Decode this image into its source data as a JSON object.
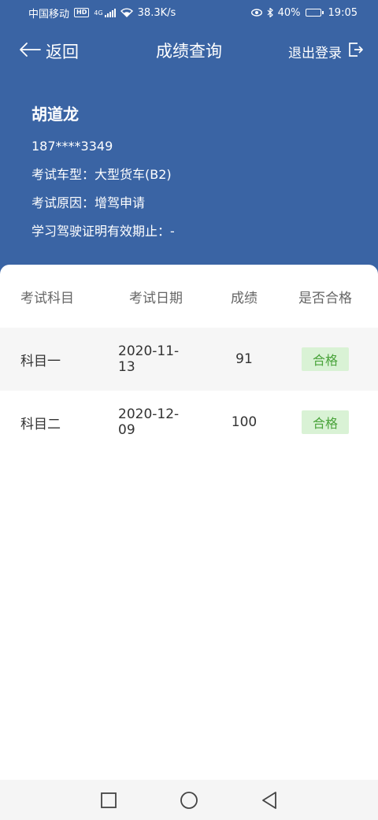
{
  "status_bar": {
    "carrier": "中国移动",
    "hd_badge": "HD",
    "network": "4G",
    "speed": "38.3K/s",
    "battery": "40%",
    "battery_level": 0.4,
    "time": "19:05"
  },
  "nav": {
    "back_label": "返回",
    "title": "成绩查询",
    "logout_label": "退出登录"
  },
  "user": {
    "name": "胡道龙",
    "phone": "187****3349",
    "vehicle_type": "考试车型：大型货车(B2)",
    "exam_reason": "考试原因：增驾申请",
    "permit_expiry": "学习驾驶证明有效期止：-"
  },
  "table": {
    "headers": [
      "考试科目",
      "考试日期",
      "成绩",
      "是否合格"
    ],
    "rows": [
      {
        "subject": "科目一",
        "date": "2020-11-13",
        "score": "91",
        "result": "合格"
      },
      {
        "subject": "科目二",
        "date": "2020-12-09",
        "score": "100",
        "result": "合格"
      }
    ]
  },
  "colors": {
    "header_bg": "#3a64a4",
    "pass_badge_bg": "#d9f2d5",
    "pass_badge_text": "#49a33a"
  }
}
